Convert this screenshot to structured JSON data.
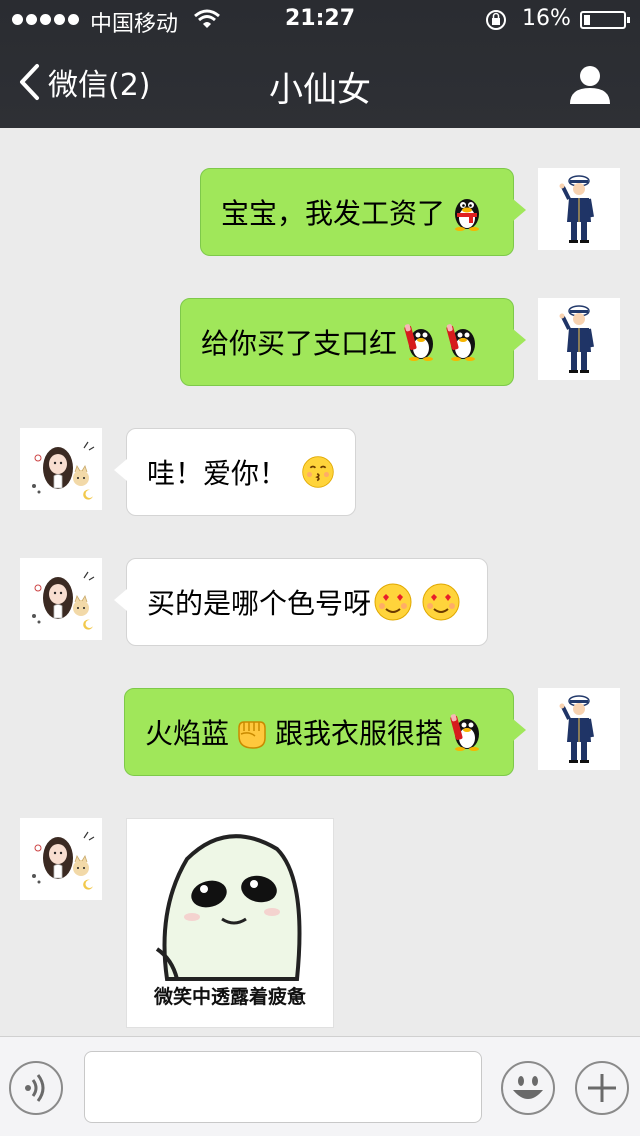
{
  "status_bar": {
    "carrier": "中国移动",
    "time": "21:27",
    "battery": "16%",
    "icons": [
      "signal-dots-icon",
      "wifi-icon",
      "rotation-lock-icon",
      "battery-icon"
    ]
  },
  "nav": {
    "back_label": "微信(2)",
    "title": "小仙女",
    "right_icon": "profile-icon"
  },
  "messages": [
    {
      "from": "me",
      "text": "宝宝，我发工资了",
      "emojis": [
        "qq-penguin-scarf"
      ]
    },
    {
      "from": "me",
      "text": "给你买了支口红",
      "emojis": [
        "qq-penguin-lipstick",
        "qq-penguin-lipstick"
      ]
    },
    {
      "from": "them",
      "text": "哇！爱你！",
      "emojis": [
        "kissing-face"
      ]
    },
    {
      "from": "them",
      "text": "买的是哪个色号呀",
      "emojis": [
        "heart-eyes-face",
        "heart-eyes-face"
      ]
    },
    {
      "from": "me",
      "text": "火焰蓝",
      "emojis": [
        "raised-fist"
      ],
      "text_after": "跟我衣服很搭",
      "emojis_after": [
        "qq-penguin-lipstick"
      ]
    },
    {
      "from": "them",
      "type": "sticker",
      "caption": "微笑中透露着疲惫"
    }
  ],
  "input_bar": {
    "placeholder": "",
    "value": "",
    "buttons": [
      "voice-icon",
      "emoji-icon",
      "plus-icon"
    ]
  },
  "colors": {
    "nav_bg": "#2e3035",
    "chat_bg": "#ebebeb",
    "my_bubble": "#a0e75a",
    "their_bubble": "#ffffff"
  }
}
